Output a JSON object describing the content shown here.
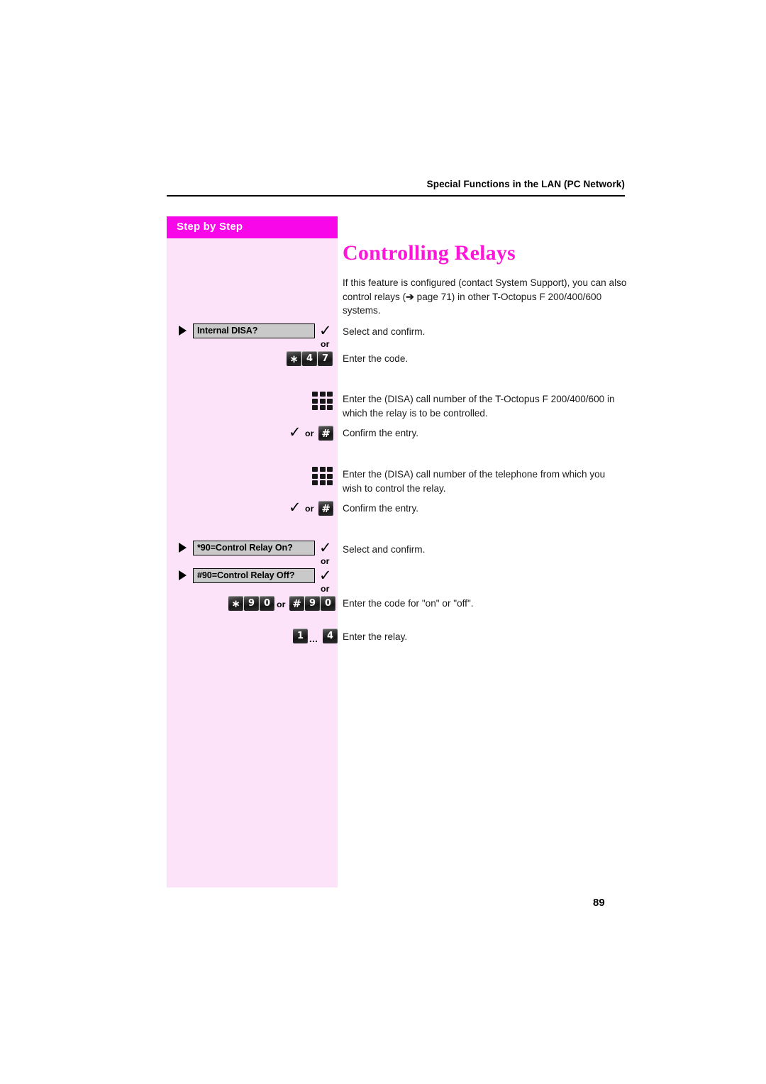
{
  "header": {
    "running_title": "Special Functions in the LAN (PC Network)"
  },
  "sidebar": {
    "bar_label": "Step by Step",
    "bar_color": "#f808e8",
    "panel_color": "#fce3f9"
  },
  "main": {
    "title": "Controlling Relays",
    "title_color": "#ff14d9",
    "intro_part1": "If this feature is configured (contact System Support), you can also control relays (",
    "intro_arrow": "➔",
    "intro_part2": " page 71) in other T-Octopus F 200/400/600 systems."
  },
  "steps": [
    {
      "id": "internal-disa",
      "menu_label": "Internal DISA?",
      "check_glyph": "✓",
      "description": "Select and confirm.",
      "or_label": "or"
    },
    {
      "id": "code-47",
      "keys": [
        "∗",
        "4",
        "7"
      ],
      "description": "Enter the code."
    },
    {
      "id": "enter-disa-number-system",
      "icon": "keypad-icon",
      "description": "Enter the (DISA) call number of the T-Octopus F 200/400/600 in which the relay is to be controlled."
    },
    {
      "id": "confirm-entry-1",
      "check_glyph": "✓",
      "or_label": "or",
      "key": "#",
      "description": "Confirm the entry."
    },
    {
      "id": "enter-disa-number-phone",
      "icon": "keypad-icon",
      "description": "Enter the (DISA) call number of the telephone from which you wish to control the relay."
    },
    {
      "id": "confirm-entry-2",
      "check_glyph": "✓",
      "or_label": "or",
      "key": "#",
      "description": "Confirm the entry."
    },
    {
      "id": "relay-on",
      "menu_label": "*90=Control Relay On?",
      "check_glyph": "✓",
      "description": "Select and confirm.",
      "or_label": "or"
    },
    {
      "id": "relay-off",
      "menu_label": "#90=Control Relay Off?",
      "check_glyph": "✓",
      "or_label": "or"
    },
    {
      "id": "code-on-off",
      "keys_a": [
        "∗",
        "9",
        "0"
      ],
      "or_label": "or",
      "keys_b": [
        "#",
        "9",
        "0"
      ],
      "description": "Enter the code for \"on\" or \"off\"."
    },
    {
      "id": "relay-range",
      "key_from": "1",
      "ellipsis": "...",
      "key_to": "4",
      "description": "Enter the relay."
    }
  ],
  "footer": {
    "page_number": "89"
  }
}
